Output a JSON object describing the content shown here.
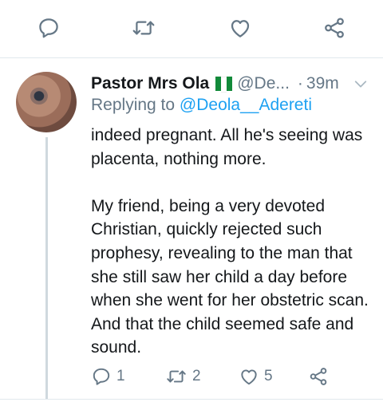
{
  "top_actions": {
    "reply_icon": "reply-bubble-icon",
    "retweet_icon": "retweet-arrows-icon",
    "like_icon": "heart-icon",
    "share_icon": "share-nodes-icon"
  },
  "tweet": {
    "author_name": "Pastor Mrs Ola",
    "author_flag": "nigeria-flag-icon",
    "handle": "@De...",
    "separator": "·",
    "time": "39m",
    "replying_prefix": "Replying to",
    "replying_to": "@Deola__Adereti",
    "paragraph_1": "indeed pregnant. All he's seeing was placenta, nothing more.",
    "paragraph_2": "My friend, being a very devoted Christian, quickly rejected such prophesy, revealing to the man that she still saw her child a day before when she went for her obstetric scan. And that the child seemed safe and sound.",
    "reply_count": "1",
    "retweet_count": "2",
    "like_count": "5"
  },
  "colors": {
    "icon_gray": "#657786",
    "link_blue": "#1da1f2",
    "text": "#14171a",
    "divider": "#e1e8ed",
    "flag_green": "#128a3a"
  }
}
